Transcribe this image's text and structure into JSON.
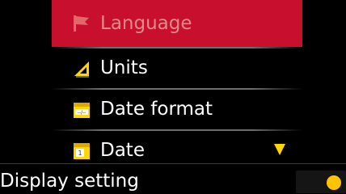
{
  "menu": {
    "items": [
      {
        "label": "Language",
        "icon": "flag-icon",
        "selected": true
      },
      {
        "label": "Units",
        "icon": "set-square-icon",
        "selected": false
      },
      {
        "label": "Date format",
        "icon": "date-format-icon",
        "selected": false
      },
      {
        "label": "Date",
        "icon": "calendar-icon",
        "selected": false
      }
    ]
  },
  "scroll_indicator": {
    "icon": "scroll-down-arrow-icon"
  },
  "status": {
    "title": "Display setting",
    "indicator_icon": "status-dot-icon"
  },
  "colors": {
    "background": "#000000",
    "selection": "#c8102e",
    "selected_text": "#e58a8a",
    "text": "#ffffff",
    "accent_yellow": "#ffd600"
  }
}
